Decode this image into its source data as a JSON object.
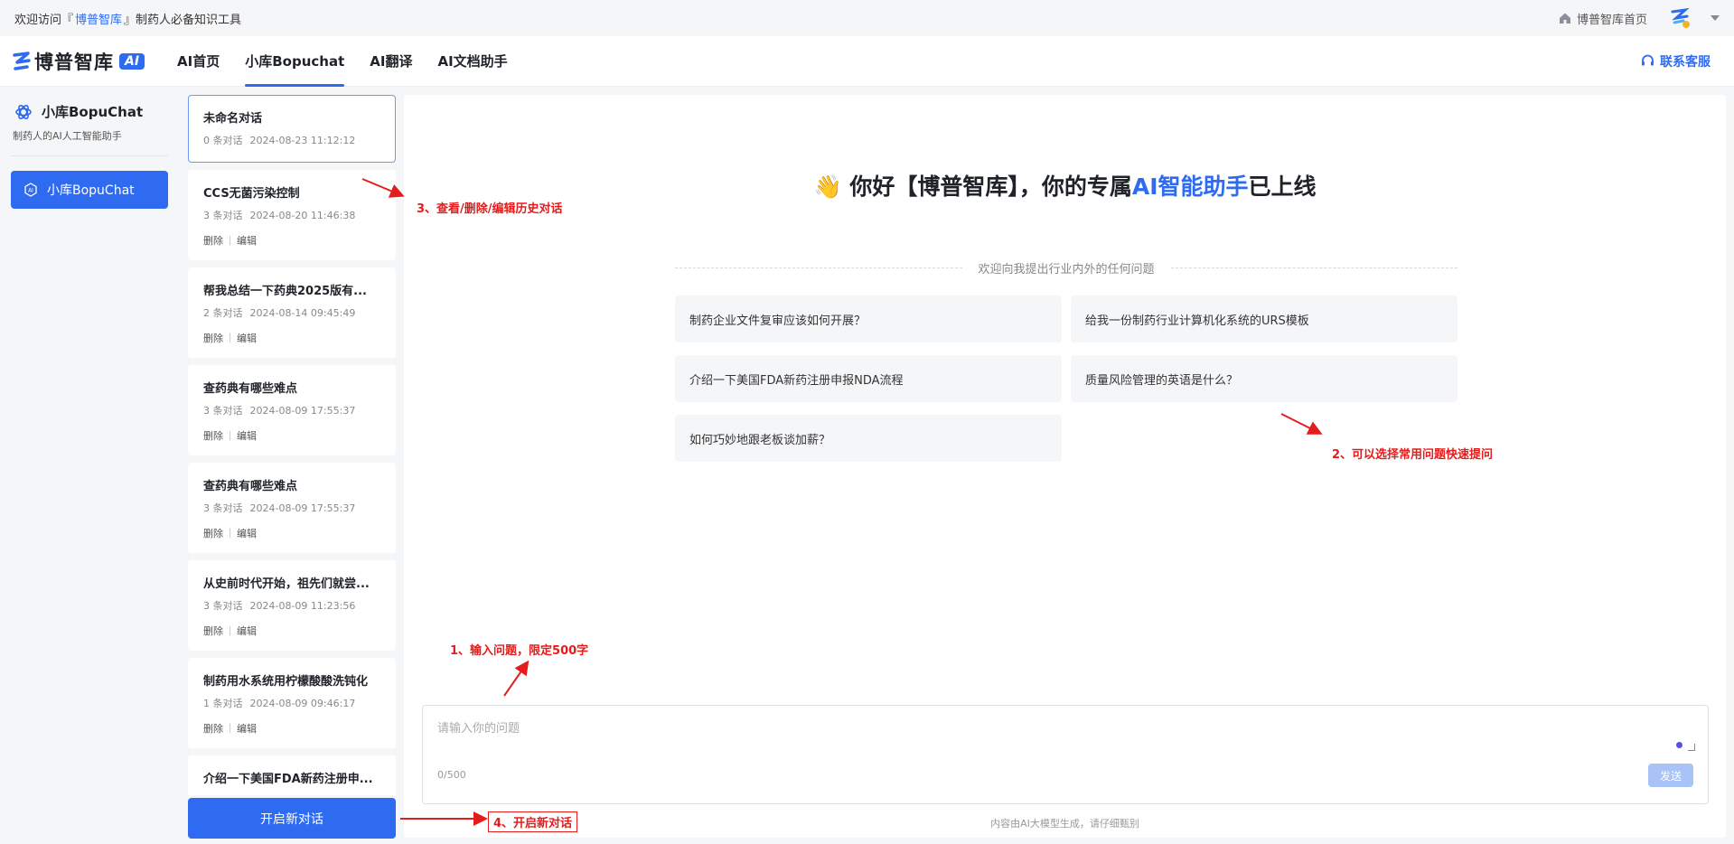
{
  "topbar": {
    "prefix": "欢迎访问『",
    "brand": "博普智库",
    "suffix": "』制药人必备知识工具",
    "home_link": "博普智库首页"
  },
  "navbar": {
    "logo_name": "博普智库",
    "logo_badge": "AI",
    "items": [
      {
        "label": "AI首页",
        "active": false
      },
      {
        "label": "小库Bopuchat",
        "active": true
      },
      {
        "label": "AI翻译",
        "active": false
      },
      {
        "label": "AI文档助手",
        "active": false
      }
    ],
    "contact": "联系客服"
  },
  "sidebar": {
    "title": "小库BopuChat",
    "subtitle": "制药人的AI人工智能助手",
    "button": "小库BopuChat"
  },
  "history": [
    {
      "title": "未命名对话",
      "count": "0 条对话",
      "time": "2024-08-23 11:12:12",
      "selected": true
    },
    {
      "title": "CCS无菌污染控制",
      "count": "3 条对话",
      "time": "2024-08-20 11:46:38",
      "delete": "删除",
      "edit": "编辑"
    },
    {
      "title": "帮我总结一下药典2025版有...",
      "count": "2 条对话",
      "time": "2024-08-14 09:45:49",
      "delete": "删除",
      "edit": "编辑"
    },
    {
      "title": "查药典有哪些难点",
      "count": "3 条对话",
      "time": "2024-08-09 17:55:37",
      "delete": "删除",
      "edit": "编辑"
    },
    {
      "title": "查药典有哪些难点",
      "count": "3 条对话",
      "time": "2024-08-09 17:55:37",
      "delete": "删除",
      "edit": "编辑"
    },
    {
      "title": "从史前时代开始，祖先们就尝...",
      "count": "3 条对话",
      "time": "2024-08-09 11:23:56",
      "delete": "删除",
      "edit": "编辑"
    },
    {
      "title": "制药用水系统用柠檬酸酸洗钝化",
      "count": "1 条对话",
      "time": "2024-08-09 09:46:17",
      "delete": "删除",
      "edit": "编辑"
    },
    {
      "title": "介绍一下美国FDA新药注册申...",
      "count": "",
      "time": ""
    }
  ],
  "new_chat_button": "开启新对话",
  "main": {
    "greeting_emoji": "👋",
    "greeting_part1": "你好【博普智库】，你的专属",
    "greeting_accent": "AI智能助手",
    "greeting_part2": "已上线",
    "divider_text": "欢迎向我提出行业内外的任何问题",
    "suggestions": [
      "制药企业文件复审应该如何开展？",
      "给我一份制药行业计算机化系统的URS模板",
      "介绍一下美国FDA新药注册申报NDA流程",
      "质量风险管理的英语是什么？",
      "如何巧妙地跟老板谈加薪？"
    ],
    "input_placeholder": "请输入你的问题",
    "counter": "0/500",
    "send": "发送",
    "disclaimer": "内容由AI大模型生成，请仔细甄别"
  },
  "annotations": {
    "a1": "1、输入问题，限定500字",
    "a2": "2、可以选择常用问题快速提问",
    "a3": "3、查看/删除/编辑历史对话",
    "a4": "4、开启新对话"
  },
  "colors": {
    "accent": "#2f6bf0",
    "annotation": "#e51c1c"
  }
}
